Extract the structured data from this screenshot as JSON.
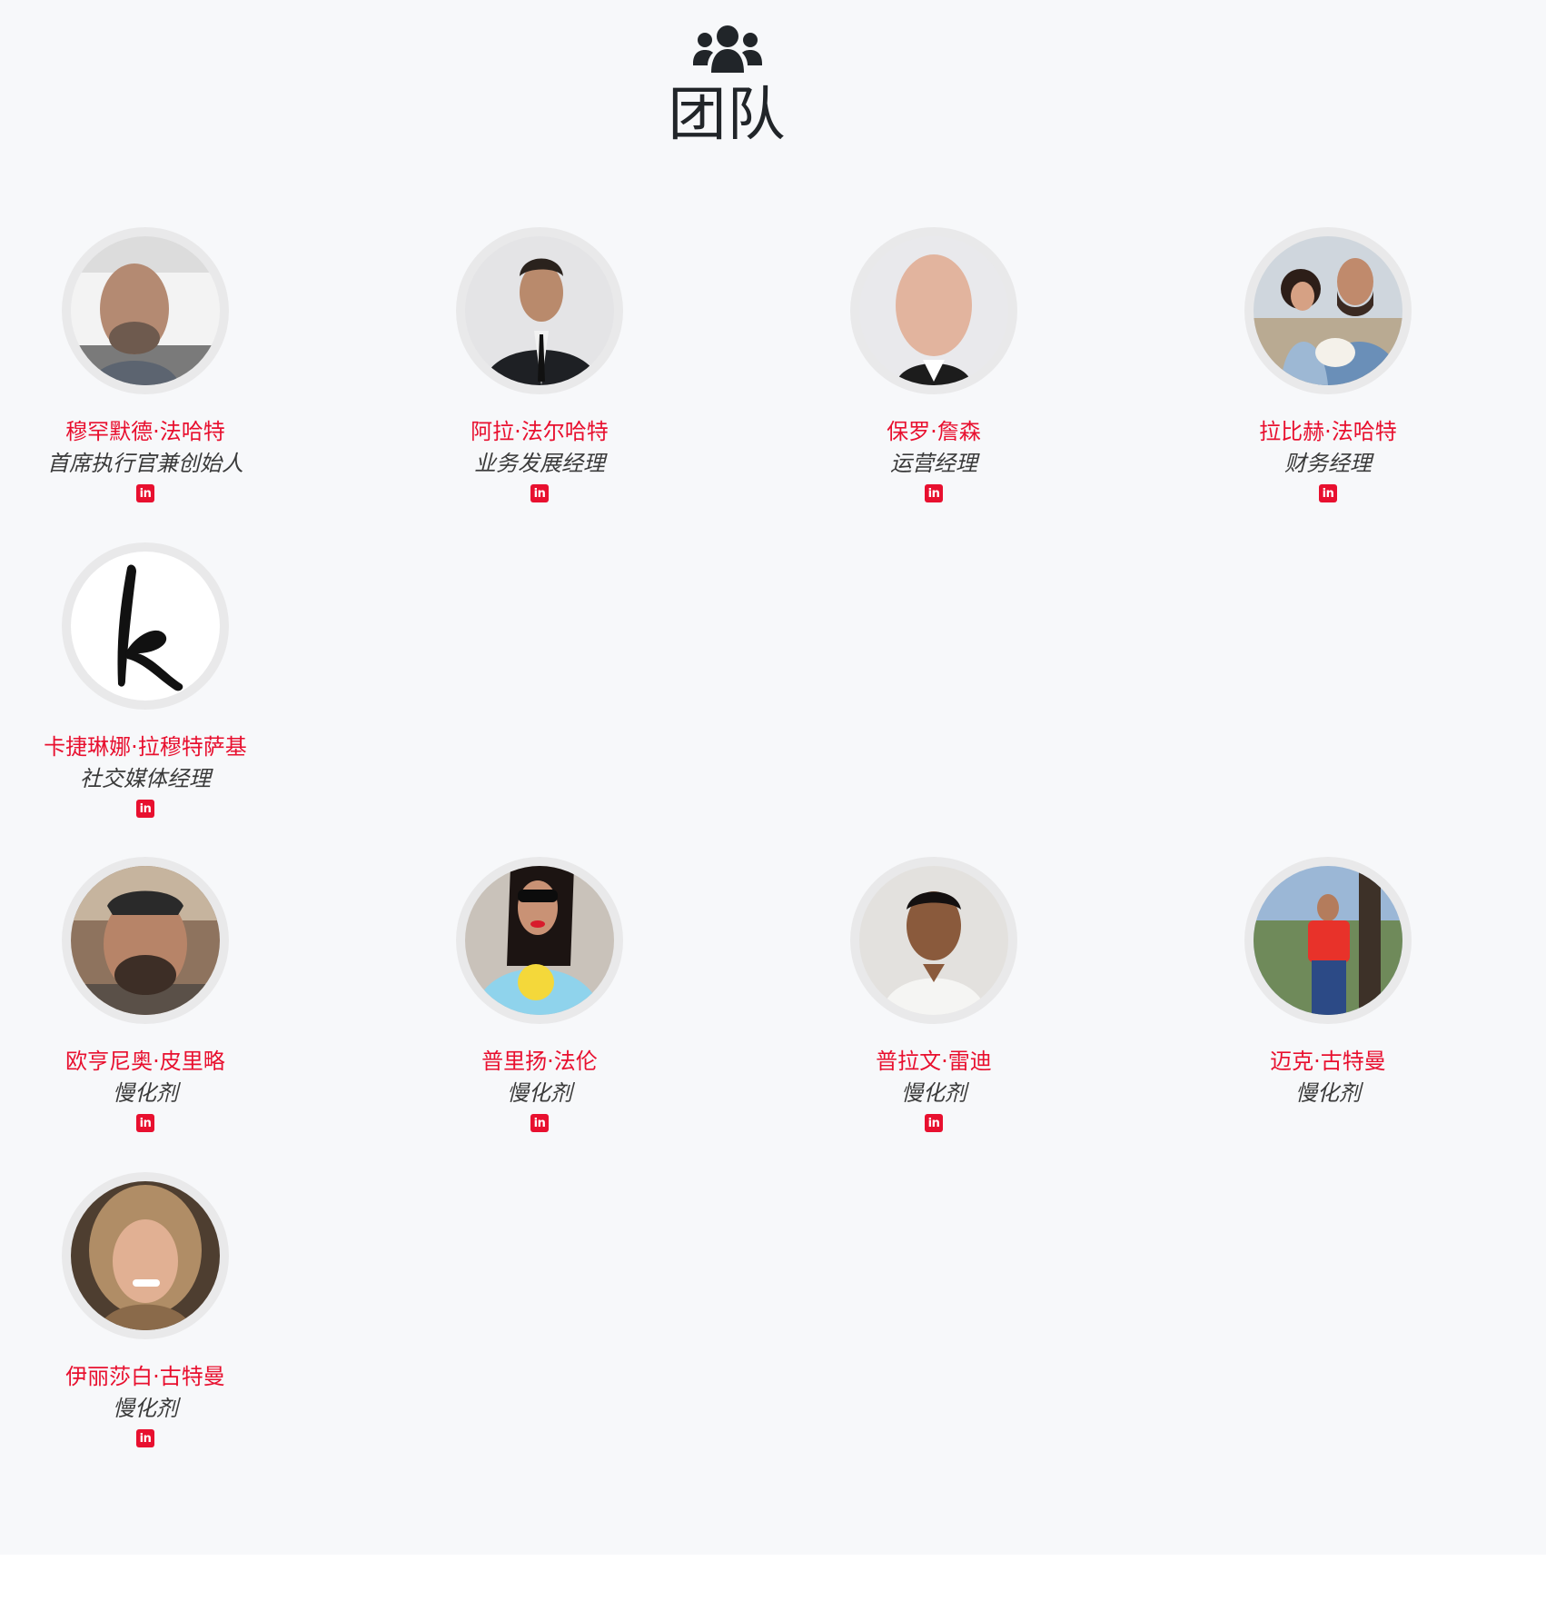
{
  "section": {
    "icon": "users-icon",
    "title": "团队"
  },
  "accent_color": "#e8102f",
  "members": [
    {
      "name": "穆罕默德·法哈特",
      "role": "首席执行官兼创始人",
      "has_linkedin": true,
      "linkedin_label": "in"
    },
    {
      "name": "阿拉·法尔哈特",
      "role": "业务发展经理",
      "has_linkedin": true,
      "linkedin_label": "in"
    },
    {
      "name": "保罗·詹森",
      "role": "运营经理",
      "has_linkedin": true,
      "linkedin_label": "in"
    },
    {
      "name": "拉比赫·法哈特",
      "role": "财务经理",
      "has_linkedin": true,
      "linkedin_label": "in"
    },
    {
      "name": "卡捷琳娜·拉穆特萨基",
      "role": "社交媒体经理",
      "has_linkedin": true,
      "linkedin_label": "in"
    },
    {
      "name": "欧亨尼奥·皮里略",
      "role": "慢化剂",
      "has_linkedin": true,
      "linkedin_label": "in"
    },
    {
      "name": "普里扬·法伦",
      "role": "慢化剂",
      "has_linkedin": true,
      "linkedin_label": "in"
    },
    {
      "name": "普拉文·雷迪",
      "role": "慢化剂",
      "has_linkedin": true,
      "linkedin_label": "in"
    },
    {
      "name": "迈克·古特曼",
      "role": "慢化剂",
      "has_linkedin": false,
      "linkedin_label": ""
    },
    {
      "name": "伊丽莎白·古特曼",
      "role": "慢化剂",
      "has_linkedin": true,
      "linkedin_label": "in"
    }
  ]
}
